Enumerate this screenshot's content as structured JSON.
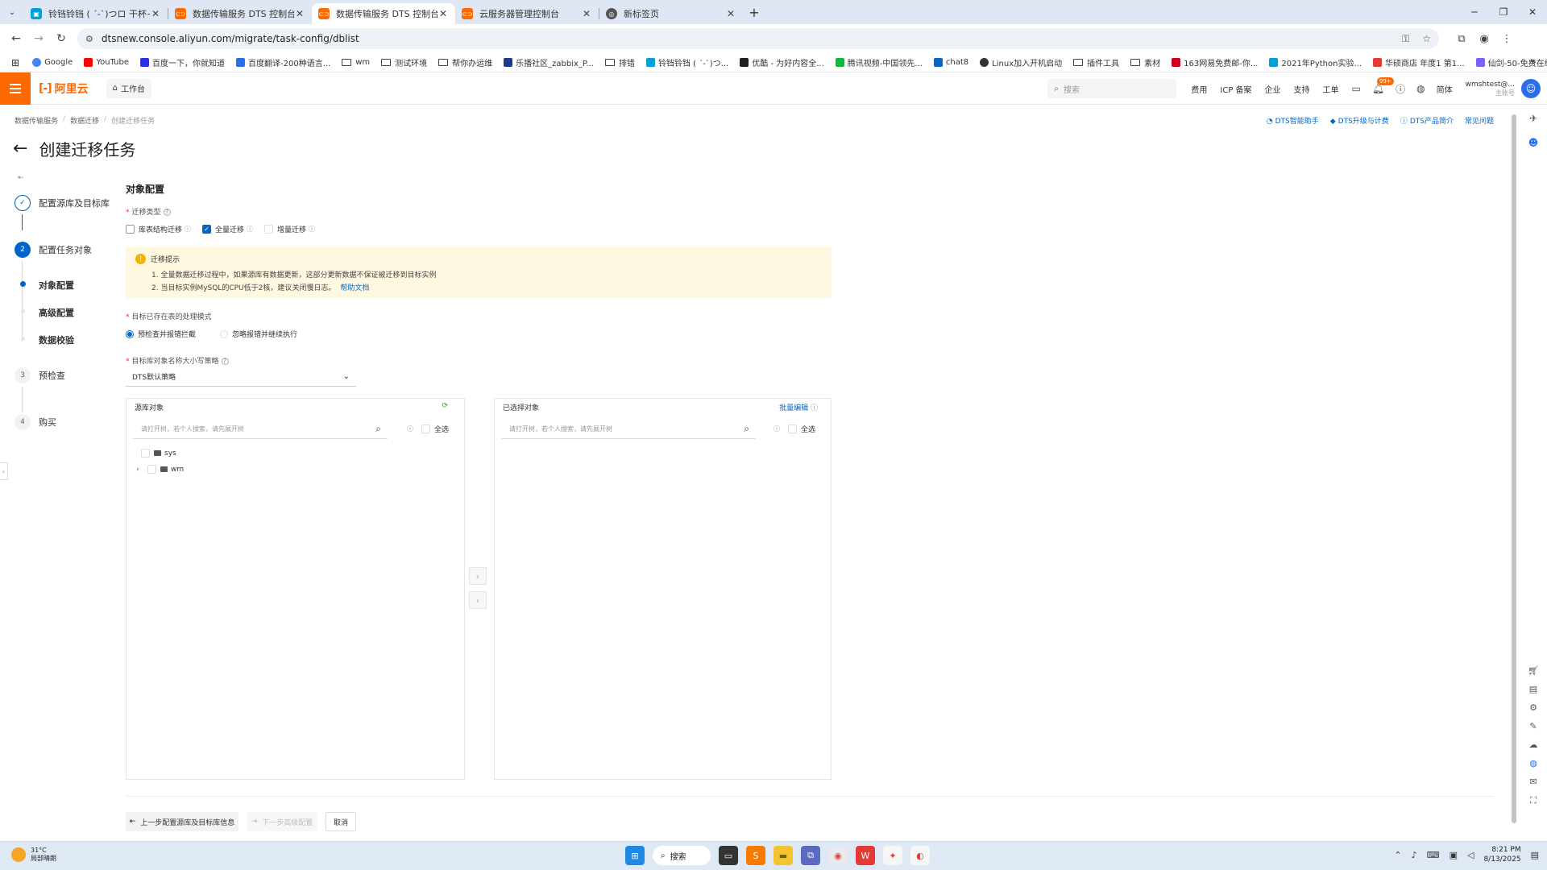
{
  "browser": {
    "tabs": [
      {
        "title": "铃铛铃铛 ( ´-`)つロ 干杯~-bili",
        "color": "#00a1d6",
        "active": false
      },
      {
        "title": "数据传输服务 DTS 控制台",
        "color": "#ff6a00",
        "active": false
      },
      {
        "title": "数据传输服务 DTS 控制台",
        "color": "#ff6a00",
        "active": true
      },
      {
        "title": "云服务器管理控制台",
        "color": "#ff6a00",
        "active": false
      },
      {
        "title": "新标签页",
        "color": "#555555",
        "active": false
      }
    ],
    "url": "dtsnew.console.aliyun.com/migrate/task-config/dblist",
    "bookmarks": [
      {
        "label": "Google",
        "type": "site",
        "color": "#4285f4"
      },
      {
        "label": "YouTube",
        "type": "site",
        "color": "#ff0000"
      },
      {
        "label": "百度一下，你就知道",
        "type": "site",
        "color": "#2932e1"
      },
      {
        "label": "百度翻译-200种语言...",
        "type": "site",
        "color": "#2a6ee8"
      },
      {
        "label": "wm",
        "type": "folder"
      },
      {
        "label": "测试环境",
        "type": "folder"
      },
      {
        "label": "帮你办运维",
        "type": "folder"
      },
      {
        "label": "乐播社区_zabbix_P...",
        "type": "site",
        "color": "#1e3a8a"
      },
      {
        "label": "排错",
        "type": "folder"
      },
      {
        "label": "铃铛铃铛 ( ´-`)つ...",
        "type": "site",
        "color": "#00a1d6"
      },
      {
        "label": "优酷 - 为好内容全...",
        "type": "site",
        "color": "#1f1f1f"
      },
      {
        "label": "腾讯视频-中国领先...",
        "type": "site",
        "color": "#10b93b"
      },
      {
        "label": "chat8",
        "type": "site",
        "color": "#0a66c2"
      },
      {
        "label": "Linux加入开机启动",
        "type": "site",
        "color": "#333333"
      },
      {
        "label": "插件工具",
        "type": "folder"
      },
      {
        "label": "素材",
        "type": "folder"
      },
      {
        "label": "163网易免费邮-你...",
        "type": "site",
        "color": "#d0021b"
      },
      {
        "label": "2021年Python实验...",
        "type": "site",
        "color": "#00a1d6"
      },
      {
        "label": "华硕商店 年度1 第1...",
        "type": "site",
        "color": "#e53935"
      },
      {
        "label": "仙剑-50-免费在线...",
        "type": "site",
        "color": "#7b61ff"
      }
    ]
  },
  "console": {
    "logo": "阿里云",
    "workbench": "工作台",
    "search_placeholder": "搜索",
    "nav": [
      "费用",
      "ICP 备案",
      "企业",
      "支持",
      "工单"
    ],
    "notify_badge": "99+",
    "lang": "简体",
    "account_name": "wmshtest@...",
    "account_sub": "主账号"
  },
  "page": {
    "breadcrumbs": [
      "数据传输服务",
      "数据迁移",
      "创建迁移任务"
    ],
    "help_links": [
      "DTS智能助手",
      "DTS升级与计费",
      "DTS产品简介",
      "常见问题"
    ],
    "title": "创建迁移任务",
    "steps": [
      {
        "num": "1",
        "label": "配置源库及目标库",
        "state": "done"
      },
      {
        "num": "2",
        "label": "配置任务对象",
        "state": "current"
      },
      {
        "num": "3",
        "label": "预检查",
        "state": "todo"
      },
      {
        "num": "4",
        "label": "购买",
        "state": "todo"
      }
    ],
    "substeps": [
      "对象配置",
      "高级配置",
      "数据校验"
    ],
    "section_title": "对象配置",
    "migrate_type_label": "迁移类型",
    "migrate_types": [
      {
        "label": "库表结构迁移",
        "checked": false
      },
      {
        "label": "全量迁移",
        "checked": true
      },
      {
        "label": "增量迁移",
        "checked": false
      }
    ],
    "notice": {
      "title": "迁移提示",
      "lines": [
        "1. 全量数据迁移过程中，如果源库有数据更新，这部分更新数据不保证被迁移到目标实例",
        "2. 当目标实例MySQL的CPU低于2核，建议关闭慢日志。"
      ],
      "link": "帮助文档"
    },
    "conflict_label": "目标已存在表的处理模式",
    "conflict_options": [
      {
        "label": "预检查并报错拦截",
        "selected": true
      },
      {
        "label": "忽略报错并继续执行",
        "selected": false
      }
    ],
    "case_label": "目标库对象名称大小写策略",
    "case_value": "DTS默认策略",
    "source_panel": {
      "title": "源库对象",
      "search_placeholder": "请打开树，若个人搜索，请先展开树",
      "select_all": "全选",
      "items": [
        {
          "label": "sys",
          "expandable": false
        },
        {
          "label": "wm",
          "expandable": true
        }
      ]
    },
    "selected_panel": {
      "title": "已选择对象",
      "batch_edit": "批量编辑",
      "search_placeholder": "请打开树，若个人搜索，请先展开树",
      "select_all": "全选"
    },
    "footer": {
      "prev": "上一步配置源库及目标库信息",
      "next": "下一步高级配置",
      "cancel": "取消"
    }
  },
  "taskbar": {
    "temp": "31°C",
    "weather": "局部晴朗",
    "search": "搜索",
    "time": "8:21 PM",
    "date": "8/13/2025"
  }
}
